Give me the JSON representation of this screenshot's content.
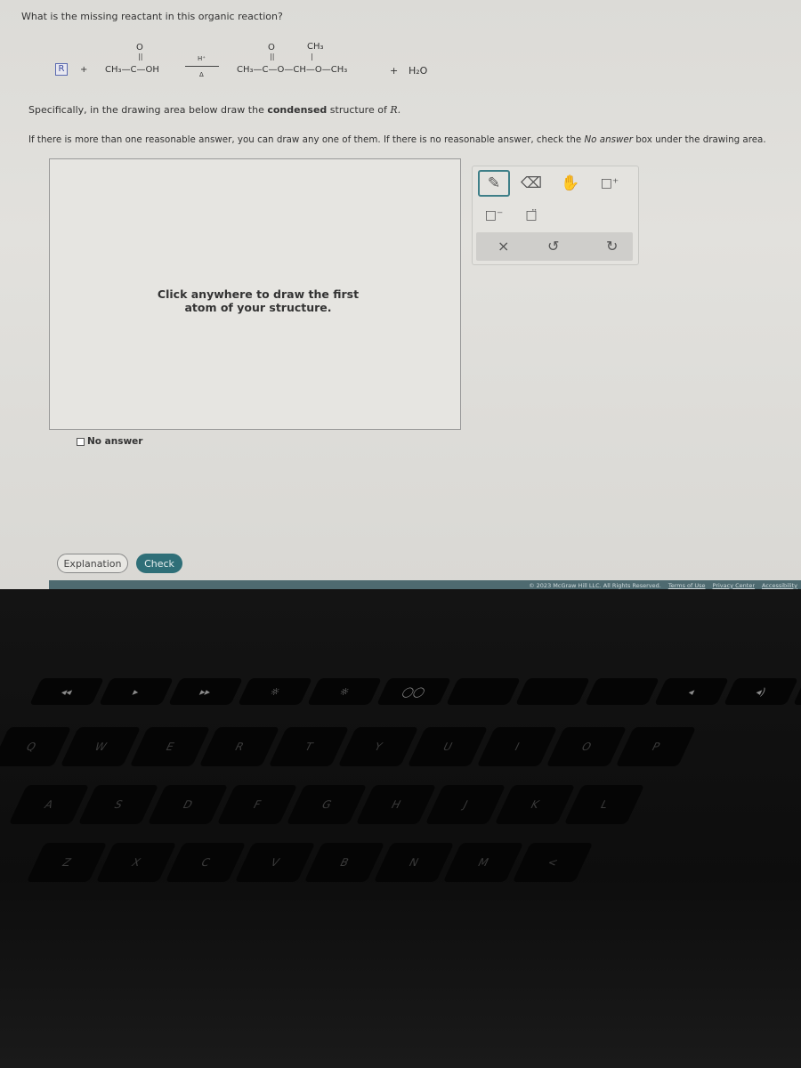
{
  "question": "What is the missing reactant in this organic reaction?",
  "reaction": {
    "missing": "R",
    "plus1": "+",
    "reactant_main": "CH₃—C—OH",
    "reactant_o": "O",
    "dbl": "||",
    "catalyst": "H⁺",
    "condition": "Δ",
    "product_main": "CH₃—C—O—CH—O—CH₃",
    "product_o": "O",
    "product_ch3": "CH₃",
    "vbar": "|",
    "plus2": "+",
    "water": "H₂O"
  },
  "instructions": {
    "line1_a": "Specifically, in the drawing area below draw the ",
    "line1_bold": "condensed",
    "line1_b": " structure of ",
    "line1_r": "R.",
    "line2_a": "If there is more than one reasonable answer, you can draw any one of them. If there is no reasonable answer, check the ",
    "line2_i": "No answer",
    "line2_b": " box under the drawing area."
  },
  "canvas": {
    "hint": "Click anywhere to draw the first atom of your structure."
  },
  "toolbar": {
    "pencil": "✎",
    "eraser": "⌫",
    "hand": "✋",
    "add_charge": "□⁺",
    "remove_charge": "□⁻",
    "lone_pair": "□̈",
    "clear": "×",
    "undo": "↺",
    "redo": "↻"
  },
  "no_answer": "No answer",
  "buttons": {
    "explanation": "Explanation",
    "check": "Check"
  },
  "footer": {
    "copyright": "© 2023 McGraw Hill LLC. All Rights Reserved.",
    "terms": "Terms of Use",
    "privacy": "Privacy Center",
    "accessibility": "Accessibility"
  },
  "keyboard": {
    "frow": [
      "◂◂",
      "▸",
      "▸▸",
      "☼",
      "☼",
      "◯◯",
      "",
      "",
      "",
      "◂",
      "◂)",
      "◂))"
    ],
    "row1": [
      "Q",
      "W",
      "E",
      "R",
      "T",
      "Y",
      "U",
      "I",
      "O",
      "P"
    ],
    "row2": [
      "A",
      "S",
      "D",
      "F",
      "G",
      "H",
      "J",
      "K",
      "L"
    ],
    "row3": [
      "Z",
      "X",
      "C",
      "V",
      "B",
      "N",
      "M",
      "<"
    ]
  }
}
